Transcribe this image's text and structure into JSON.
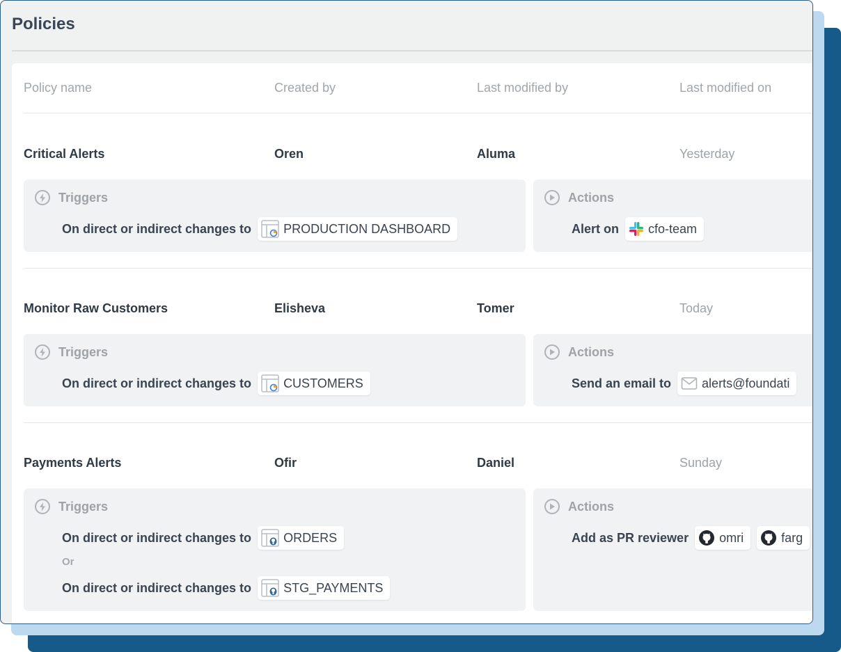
{
  "page": {
    "title": "Policies"
  },
  "table": {
    "headers": {
      "policy_name": "Policy name",
      "created_by": "Created by",
      "last_modified_by": "Last modified by",
      "last_modified_on": "Last modified on"
    }
  },
  "policies": [
    {
      "name": "Critical Alerts",
      "created_by": "Oren",
      "modified_by": "Aluma",
      "modified_on": "Yesterday",
      "triggers_label": "Triggers",
      "triggers": [
        {
          "text": "On direct or indirect changes to",
          "asset": "PRODUCTION DASHBOARD",
          "icon": "dashboard-icon"
        }
      ],
      "actions_label": "Actions",
      "action_text": "Alert on",
      "action_targets": [
        {
          "label": "cfo-team",
          "icon": "slack-icon"
        }
      ]
    },
    {
      "name": "Monitor Raw Customers",
      "created_by": "Elisheva",
      "modified_by": "Tomer",
      "modified_on": "Today",
      "triggers_label": "Triggers",
      "triggers": [
        {
          "text": "On direct or indirect changes to",
          "asset": "CUSTOMERS",
          "icon": "dashboard-icon"
        }
      ],
      "actions_label": "Actions",
      "action_text": "Send an email to",
      "action_targets": [
        {
          "label": "alerts@foundati",
          "icon": "mail-icon"
        }
      ]
    },
    {
      "name": "Payments Alerts",
      "created_by": "Ofir",
      "modified_by": "Daniel",
      "modified_on": "Sunday",
      "triggers_label": "Triggers",
      "triggers": [
        {
          "text": "On direct or indirect changes to",
          "asset": "ORDERS",
          "icon": "postgres-table-icon"
        },
        {
          "text": "On direct or indirect changes to",
          "asset": "STG_PAYMENTS",
          "icon": "postgres-table-icon"
        }
      ],
      "or_label": "Or",
      "actions_label": "Actions",
      "action_text": "Add as PR reviewer",
      "action_targets": [
        {
          "label": "omri",
          "icon": "github-icon"
        },
        {
          "label": "farg",
          "icon": "github-icon"
        }
      ]
    }
  ],
  "colors": {
    "accent_dark": "#155a88",
    "accent_light": "#bdd9ef",
    "panel_bg": "#f1f2f3"
  }
}
